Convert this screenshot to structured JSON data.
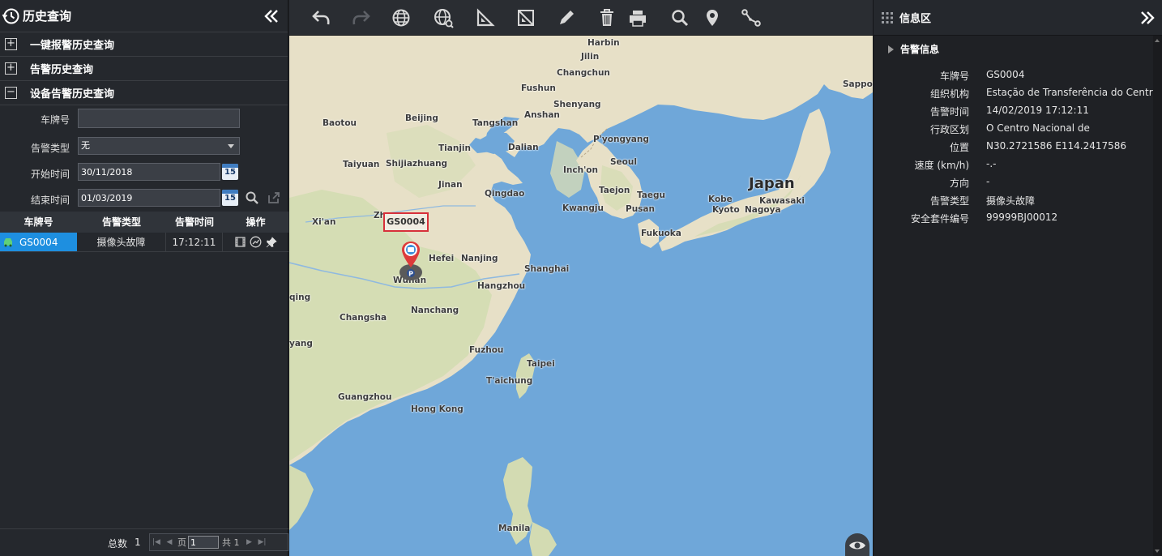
{
  "left": {
    "title": "历史查询",
    "sections": [
      {
        "label": "一键报警历史查询",
        "icon": "plus"
      },
      {
        "label": "告警历史查询",
        "icon": "plus"
      },
      {
        "label": "设备告警历史查询",
        "icon": "minus"
      }
    ],
    "form": {
      "plate_label": "车牌号",
      "plate_value": "",
      "alarm_type_label": "告警类型",
      "alarm_type_value": "无",
      "start_label": "开始时间",
      "start_value": "30/11/2018",
      "end_label": "结束时间",
      "end_value": "01/03/2019",
      "calendar_day": "15"
    },
    "table": {
      "headers": [
        "车牌号",
        "告警类型",
        "告警时间",
        "操作"
      ],
      "rows": [
        {
          "plate": "GS0004",
          "type": "摄像头故障",
          "time": "17:12:11"
        }
      ]
    },
    "pager": {
      "total_label": "总数",
      "total": "1",
      "page_label": "页",
      "page_value": "1",
      "of_label": "共 1"
    }
  },
  "map": {
    "vehicle_label": "GS0004",
    "marker_letter": "P",
    "country_label": "Japan",
    "cities": [
      "Harbin",
      "Jilin",
      "Changchun",
      "Fushun",
      "Shenyang",
      "Anshan",
      "Baotou",
      "Beijing",
      "Tangshan",
      "Tianjin",
      "Dalian",
      "P'yongyang",
      "Taiyuan",
      "Shijiazhuang",
      "Inch'on",
      "Seoul",
      "Jinan",
      "Qingdao",
      "Taejon",
      "Taegu",
      "Kwangju",
      "Pusan",
      "Xi'an",
      "Zh",
      "Fukuoka",
      "Kobe",
      "Kyoto",
      "Nagoya",
      "Kawasaki",
      "Sapporo",
      "Hefei",
      "Nanjing",
      "Shanghai",
      "Wuhan",
      "Hangzhou",
      "Changsha",
      "Nanchang",
      "Fuzhou",
      "Taipei",
      "T'aichung",
      "Guangzhou",
      "Hong Kong",
      "Manila",
      "qing",
      "yang"
    ]
  },
  "right": {
    "title": "信息区",
    "section_label": "告警信息",
    "rows": [
      {
        "key": "车牌号",
        "value": "GS0004"
      },
      {
        "key": "组织机构",
        "value": "Estação de Transferência do Centro N"
      },
      {
        "key": "告警时间",
        "value": "14/02/2019 17:12:11"
      },
      {
        "key": "行政区划",
        "value": "O Centro Nacional de"
      },
      {
        "key": "位置",
        "value": "N30.2721586 E114.2417586"
      },
      {
        "key": "速度 (km/h)",
        "value": "-.-"
      },
      {
        "key": "方向",
        "value": "-"
      },
      {
        "key": "告警类型",
        "value": "摄像头故障"
      },
      {
        "key": "安全套件编号",
        "value": "99999BJ00012"
      }
    ]
  },
  "colors": {
    "selected_row": "#1e8fe0",
    "sea": "#6fa7d9",
    "land": "#e9e1c8",
    "alarm_red": "#d7303a"
  }
}
